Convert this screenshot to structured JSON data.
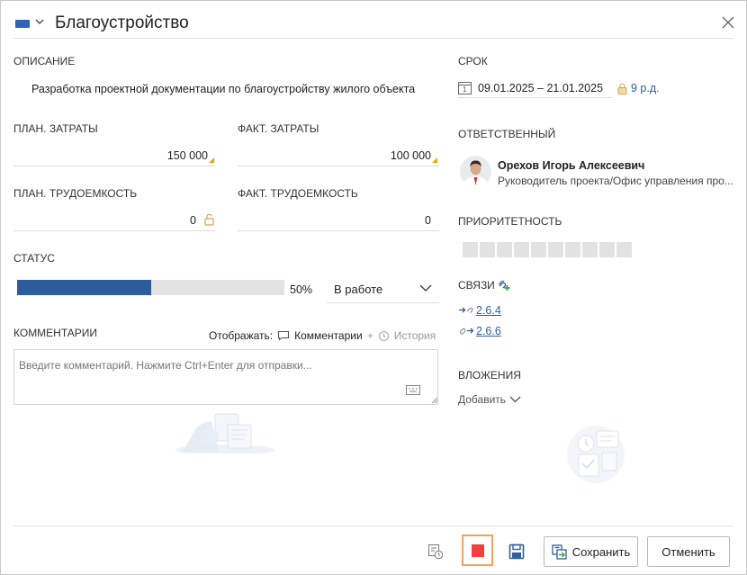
{
  "header": {
    "title": "Благоустройство",
    "flag_icon": "blue-flag-icon",
    "accent": "#2f63b4"
  },
  "description": {
    "label": "ОПИСАНИЕ",
    "text": "Разработка проектной документации по благоустройству жилого объекта"
  },
  "costs": {
    "plan_label": "ПЛАН. ЗАТРАТЫ",
    "plan_value": "150 000",
    "fact_label": "ФАКТ. ЗАТРАТЫ",
    "fact_value": "100 000"
  },
  "labor": {
    "plan_label": "ПЛАН. ТРУДОЕМКОСТЬ",
    "plan_value": "0",
    "fact_label": "ФАКТ. ТРУДОЕМКОСТЬ",
    "fact_value": "0"
  },
  "status": {
    "label": "СТАТУС",
    "progress_percent": 50,
    "progress_text": "50%",
    "selected": "В работе",
    "bar_color": "#2d5c9d"
  },
  "comments": {
    "label": "КОММЕНТАРИИ",
    "show_label": "Отображать:",
    "comments_option": "Комментарии",
    "plus": "+",
    "history_option": "История",
    "placeholder": "Введите комментарий. Нажмите Ctrl+Enter для отправки..."
  },
  "deadline": {
    "label": "СРОК",
    "range": "09.01.2025 – 21.01.2025",
    "calendar_day": "1",
    "duration": "9 р.д."
  },
  "responsible": {
    "label": "ОТВЕТСТВЕННЫЙ",
    "name": "Орехов Игорь Алексеевич",
    "role": "Руководитель проекта/Офис управления про..."
  },
  "priority": {
    "label": "ПРИОРИТЕТНОСТЬ",
    "cells": 10
  },
  "links": {
    "label": "СВЯЗИ",
    "items": [
      {
        "text": "2.6.4",
        "icon": "arrow-link-icon"
      },
      {
        "text": "2.6.6",
        "icon": "chain-link-icon"
      }
    ]
  },
  "attachments": {
    "label": "ВЛОЖЕНИЯ",
    "add_label": "Добавить"
  },
  "footer": {
    "save_label": "Сохранить",
    "cancel_label": "Отменить"
  }
}
